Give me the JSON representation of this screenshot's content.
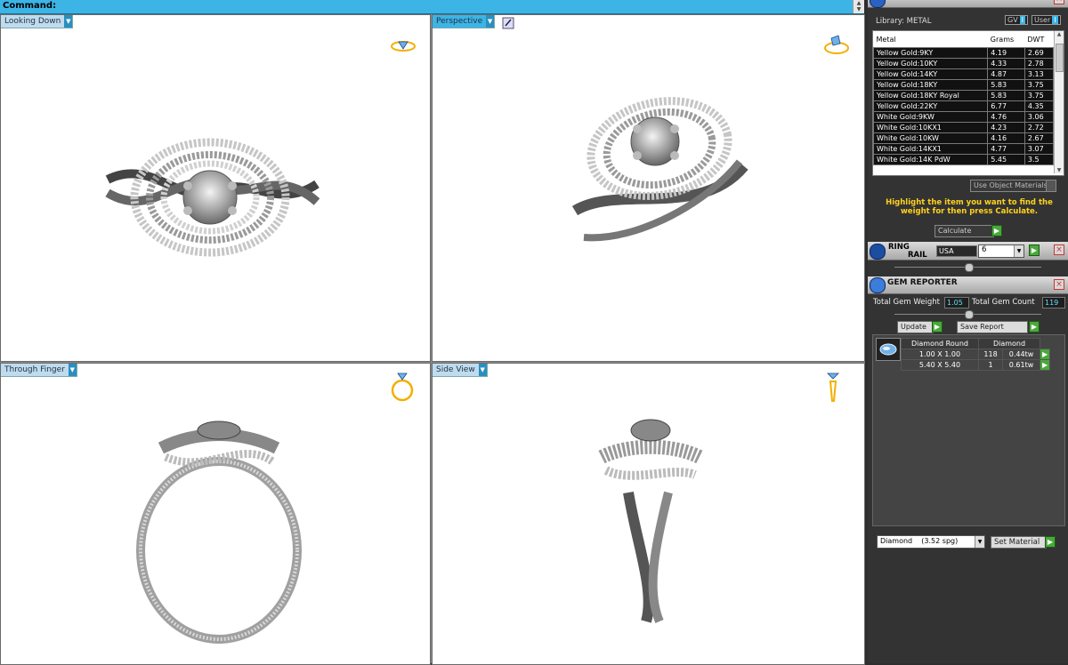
{
  "command": {
    "label": "Command:"
  },
  "viewports": [
    {
      "label": "Looking Down"
    },
    {
      "label": "Perspective"
    },
    {
      "label": "Through Finger"
    },
    {
      "label": "Side View"
    }
  ],
  "metal_weight": {
    "library_label": "Library: METAL",
    "gv_label": "GV",
    "user_label": "User",
    "columns": [
      "Metal",
      "Grams",
      "DWT"
    ],
    "rows": [
      [
        "Yellow Gold:9KY",
        "4.19",
        "2.69"
      ],
      [
        "Yellow Gold:10KY",
        "4.33",
        "2.78"
      ],
      [
        "Yellow Gold:14KY",
        "4.87",
        "3.13"
      ],
      [
        "Yellow Gold:18KY",
        "5.83",
        "3.75"
      ],
      [
        "Yellow Gold:18KY Royal",
        "5.83",
        "3.75"
      ],
      [
        "Yellow Gold:22KY",
        "6.77",
        "4.35"
      ],
      [
        "White Gold:9KW",
        "4.76",
        "3.06"
      ],
      [
        "White Gold:10KX1",
        "4.23",
        "2.72"
      ],
      [
        "White Gold:10KW",
        "4.16",
        "2.67"
      ],
      [
        "White Gold:14KX1",
        "4.77",
        "3.07"
      ],
      [
        "White Gold:14K PdW",
        "5.45",
        "3.5"
      ]
    ],
    "use_object_materials": "Use Object Materials",
    "instructions": "Highlight the item you want to find the weight for then press Calculate.",
    "calculate_label": "Calculate"
  },
  "ring_rail": {
    "title_line1": "RING",
    "title_line2": "RAIL",
    "country": "USA",
    "size": "6"
  },
  "gem_reporter": {
    "title": "GEM REPORTER",
    "total_weight_label": "Total Gem Weight",
    "total_weight_value": "1.05",
    "total_count_label": "Total Gem Count",
    "total_count_value": "119",
    "update_label": "Update",
    "save_report_label": "Save Report",
    "table_header": [
      "Diamond Round",
      "Diamond"
    ],
    "rows": [
      [
        "1.00 X 1.00",
        "118",
        "0.44tw"
      ],
      [
        "5.40 X 5.40",
        "1",
        "0.61tw"
      ]
    ],
    "material_select": "Diamond    (3.52 spg)",
    "set_material_label": "Set Material"
  }
}
